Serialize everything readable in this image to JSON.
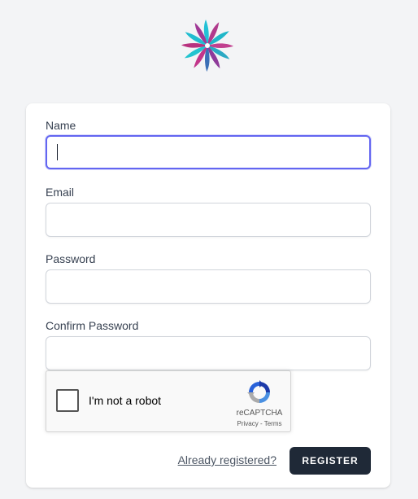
{
  "logo": {
    "icon": "flower-logo-icon"
  },
  "form": {
    "name": {
      "label": "Name",
      "value": ""
    },
    "email": {
      "label": "Email",
      "value": ""
    },
    "password": {
      "label": "Password",
      "value": ""
    },
    "confirm_password": {
      "label": "Confirm Password",
      "value": ""
    }
  },
  "recaptcha": {
    "label": "I'm not a robot",
    "brand": "reCAPTCHA",
    "privacy": "Privacy",
    "separator": " - ",
    "terms": "Terms"
  },
  "actions": {
    "login_link": "Already registered?",
    "register_button": "REGISTER"
  },
  "colors": {
    "background": "#f3f4f6",
    "card": "#ffffff",
    "focus_ring": "#6366f1",
    "button": "#1f2937"
  }
}
